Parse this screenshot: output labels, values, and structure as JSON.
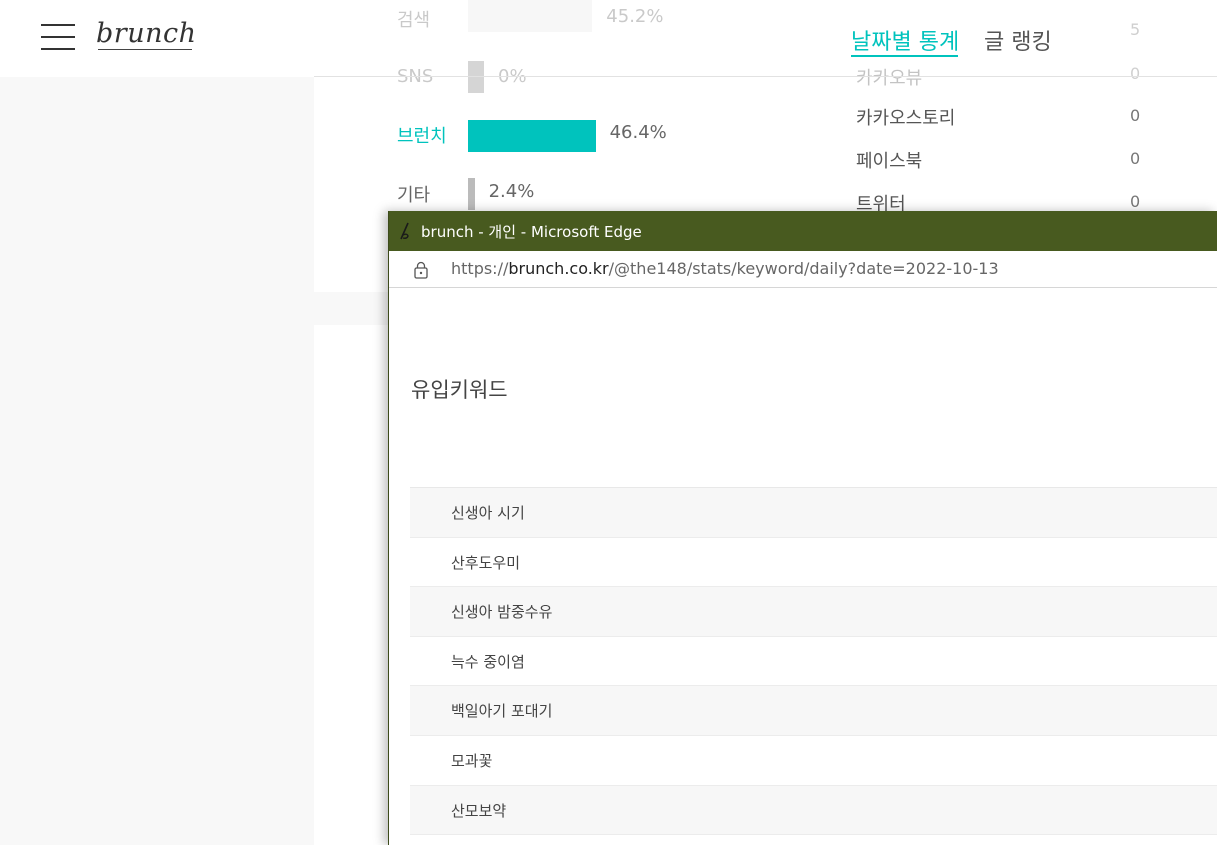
{
  "brand": {
    "logo": "brunch"
  },
  "sources": [
    {
      "label": "검색",
      "pct_text": "45.2%",
      "pct": 45.2,
      "color": "#e9e9e9"
    },
    {
      "label": "SNS",
      "pct_text": "0%",
      "pct": 0,
      "color": "#888888"
    },
    {
      "label": "브런치",
      "pct_text": "46.4%",
      "pct": 46.4,
      "color": "#00c3bd",
      "label_color": "#00c3bd"
    },
    {
      "label": "기타",
      "pct_text": "2.4%",
      "pct": 2.4,
      "color": "#bbbbbb"
    }
  ],
  "tabs": {
    "active": "날짜별 통계",
    "inactive": "글 랭킹"
  },
  "sns": {
    "top_value": "5",
    "partial_label": "카카오뷰",
    "partial_value": "0",
    "items": [
      {
        "name": "카카오스토리",
        "value": "0"
      },
      {
        "name": "페이스북",
        "value": "0"
      },
      {
        "name": "트위터",
        "value": "0"
      }
    ]
  },
  "edge": {
    "title": "brunch - 개인 - Microsoft Edge",
    "url_scheme": "https://",
    "url_host": "brunch.co.kr",
    "url_path": "/@the148/stats/keyword/daily?date=2022-10-13",
    "titlebar_color": "#485a1f"
  },
  "keywords": {
    "heading": "유입키워드",
    "items": [
      "신생아 시기",
      "산후도우미",
      "신생아 밤중수유",
      "늑수 중이염",
      "백일아기 포대기",
      "모과꽃",
      "산모보약"
    ]
  },
  "icons": {
    "menu": "hamburger-menu-icon",
    "lock": "lock-icon",
    "favicon": "brunch-favicon-icon"
  },
  "accent_color": "#00c3bd"
}
